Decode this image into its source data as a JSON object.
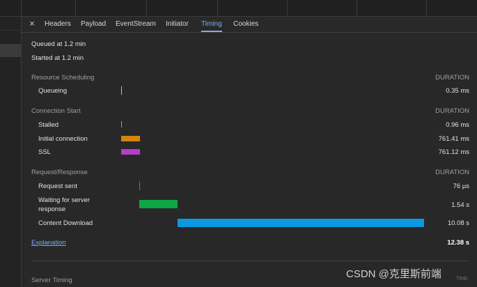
{
  "tabs": [
    {
      "label": "Headers"
    },
    {
      "label": "Payload"
    },
    {
      "label": "EventStream"
    },
    {
      "label": "Initiator"
    },
    {
      "label": "Timing"
    },
    {
      "label": "Cookies"
    }
  ],
  "close_icon": "×",
  "queued_text": "Queued at 1.2 min",
  "started_text": "Started at 1.2 min",
  "sections": {
    "resource_scheduling": {
      "title": "Resource Scheduling",
      "duration_header": "DURATION",
      "rows": [
        {
          "label": "Queueing",
          "value": "0.35 ms"
        }
      ]
    },
    "connection_start": {
      "title": "Connection Start",
      "duration_header": "DURATION",
      "rows": [
        {
          "label": "Stalled",
          "value": "0.96 ms"
        },
        {
          "label": "Initial connection",
          "value": "761.41 ms"
        },
        {
          "label": "SSL",
          "value": "761.12 ms"
        }
      ]
    },
    "request_response": {
      "title": "Request/Response",
      "duration_header": "DURATION",
      "rows": [
        {
          "label": "Request sent",
          "value": "76 µs"
        },
        {
          "label": "Waiting for server\nresponse",
          "value": "1.54 s"
        },
        {
          "label": "Content Download",
          "value": "10.08 s"
        }
      ]
    }
  },
  "explanation_link": "Explanation",
  "total_time": "12.38 s",
  "server_timing_title": "Server Timing",
  "time_label": "TIME",
  "watermark": "CSDN @克里斯前端",
  "colors": {
    "background": "#282828",
    "accent": "#7cacf8",
    "initial_connection": "#d4850f",
    "ssl": "#b43ec8",
    "waiting": "#0ea546",
    "content_download": "#0c97e0",
    "queueing_tick": "#bdbdbd",
    "request_sent_tick": "#3a9b6f"
  }
}
